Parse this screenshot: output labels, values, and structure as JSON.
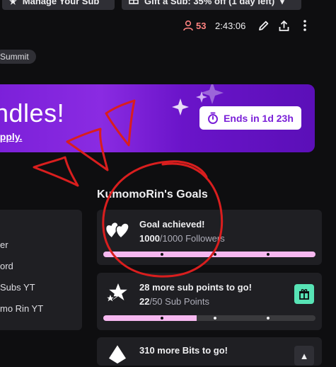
{
  "header": {
    "manage_sub_label": "Manage Your Sub",
    "gift_sub_label": "Gift a Sub: 35% off (1 day left)"
  },
  "stats": {
    "viewer_count": "53",
    "uptime": "2:43:06"
  },
  "tag": {
    "label": "Summit"
  },
  "promo": {
    "title": "ndles!",
    "link_text": "apply.",
    "ends_label": "Ends in 1d 23h"
  },
  "left_panel": {
    "items": [
      "er",
      "ord",
      "Subs YT",
      "mo Rin YT"
    ]
  },
  "goals": {
    "title": "KumomoRin's Goals",
    "cards": [
      {
        "title": "Goal achieved!",
        "current": "1000",
        "total": "/1000 Followers",
        "progress": 1.0,
        "icon": "hearts-icon"
      },
      {
        "title": "28 more sub points to go!",
        "current": "22",
        "total": "/50 Sub Points",
        "progress": 0.44,
        "icon": "stars-icon"
      },
      {
        "title": "310 more Bits to go!",
        "icon": "bits-icon"
      }
    ]
  },
  "colors": {
    "background": "#0e0e10",
    "panel": "#1f1f23",
    "accent_purple": "#8a2be2",
    "progress_pink": "#f6b8f0",
    "gift_green": "#57e3b5",
    "viewer_red": "#ff8280",
    "annotation_red": "#d91e1e"
  }
}
